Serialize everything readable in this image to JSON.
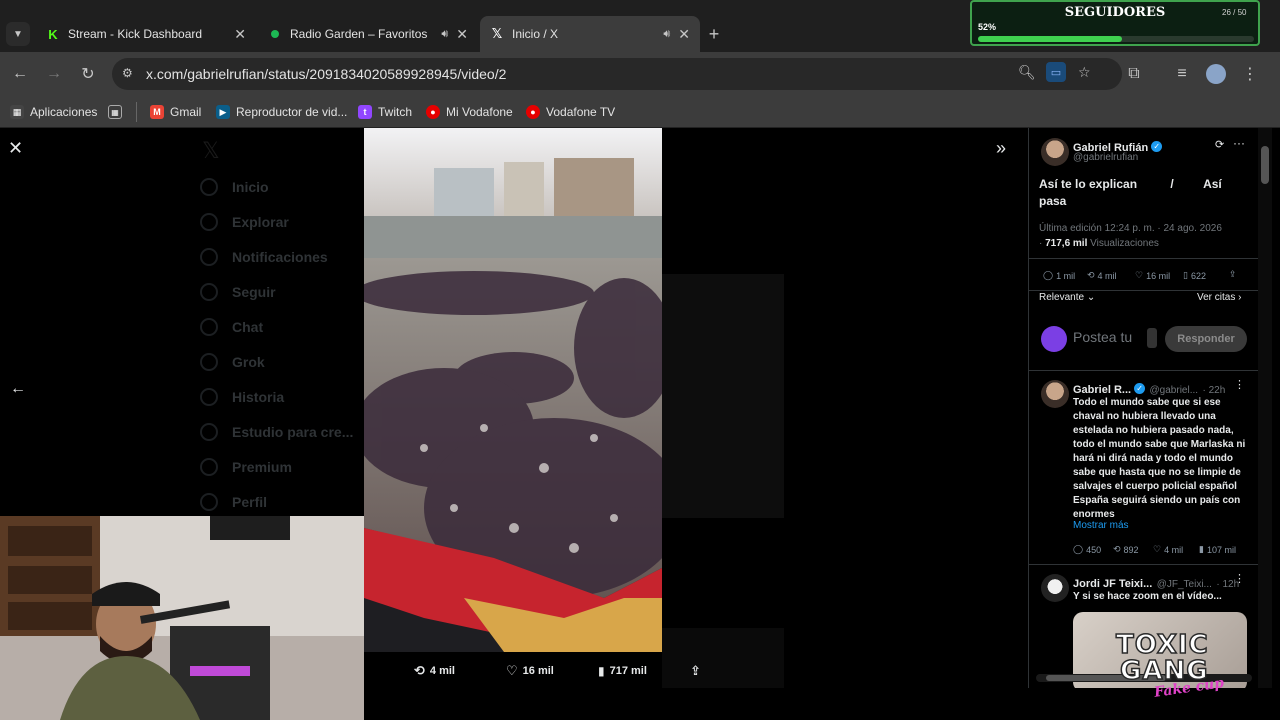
{
  "tabs": [
    {
      "title": "Stream - Kick Dashboard",
      "favicon": "kick-icon",
      "active": false
    },
    {
      "title": "Radio Garden – Favoritos",
      "favicon": "radio-garden-icon",
      "active": false,
      "audio": true
    },
    {
      "title": "Inicio / X",
      "favicon": "x-icon",
      "active": true,
      "audio": true
    }
  ],
  "toolbar": {
    "url": "x.com/gabrielrufian/status/2091834020589928945/video/2"
  },
  "bookmarks": [
    {
      "label": "Aplicaciones",
      "icon": "apps-grid-icon"
    },
    {
      "label": "Gmail",
      "icon": "gmail-icon"
    },
    {
      "label": "Reproductor de vid...",
      "icon": "video-player-icon"
    },
    {
      "label": "Twitch",
      "icon": "twitch-icon"
    },
    {
      "label": "Mi Vodafone",
      "icon": "vodafone-icon"
    },
    {
      "label": "Vodafone TV",
      "icon": "vodafone-icon"
    }
  ],
  "dimmed_nav": [
    "Inicio",
    "Explorar",
    "Notificaciones",
    "Seguir",
    "Chat",
    "Grok",
    "Historia",
    "Estudio para cre...",
    "Premium",
    "Perfil"
  ],
  "video_stats": {
    "retweets": "4 mil",
    "likes": "16 mil",
    "views": "717 mil"
  },
  "tweet": {
    "author": "Gabriel Rufián",
    "handle": "@gabrielrufian",
    "text_line1": "Así te lo explican",
    "text_sep": "/",
    "text_line1b": "Así",
    "text_line2": "pasa",
    "edited": "Última edición 12:24 p. m. · 24 ago. 2026",
    "views_count": "717,6 mil",
    "views_label": "Visualizaciones",
    "replies": "1 mil",
    "retweets": "4 mil",
    "likes": "16 mil",
    "bookmarks": "622",
    "sort": "Relevante",
    "quotes": "Ver citas",
    "compose_placeholder": "Postea tu",
    "reply_button": "Responder"
  },
  "replies": [
    {
      "author": "Gabriel R...",
      "handle": "@gabriel...",
      "time": "· 22h",
      "text": "Todo el mundo sabe que si ese chaval no hubiera llevado una estelada no hubiera pasado nada, todo el mundo sabe que Marlaska ni hará ni dirá nada y todo el mundo sabe que hasta que no se limpie de salvajes el cuerpo policial español España seguirá siendo un país con enormes",
      "more": "Mostrar más",
      "replies": "450",
      "retweets": "892",
      "likes": "4 mil",
      "views": "107 mil"
    },
    {
      "author": "Jordi JF Teixi...",
      "handle": "@JF_Teixi...",
      "time": "· 12h",
      "text": "Y si se hace zoom en el vídeo..."
    }
  ],
  "followers_overlay": {
    "title": "SEGUIDORES",
    "count": "26 / 50",
    "percent": "52%",
    "progress": 0.52
  },
  "logo": {
    "line1": "TOXIC",
    "line2": "GANG",
    "sub": "Fake cup"
  },
  "colors": {
    "accent": "#1d9bf0",
    "kick": "#53fc18",
    "progress": "#3fd14f"
  }
}
